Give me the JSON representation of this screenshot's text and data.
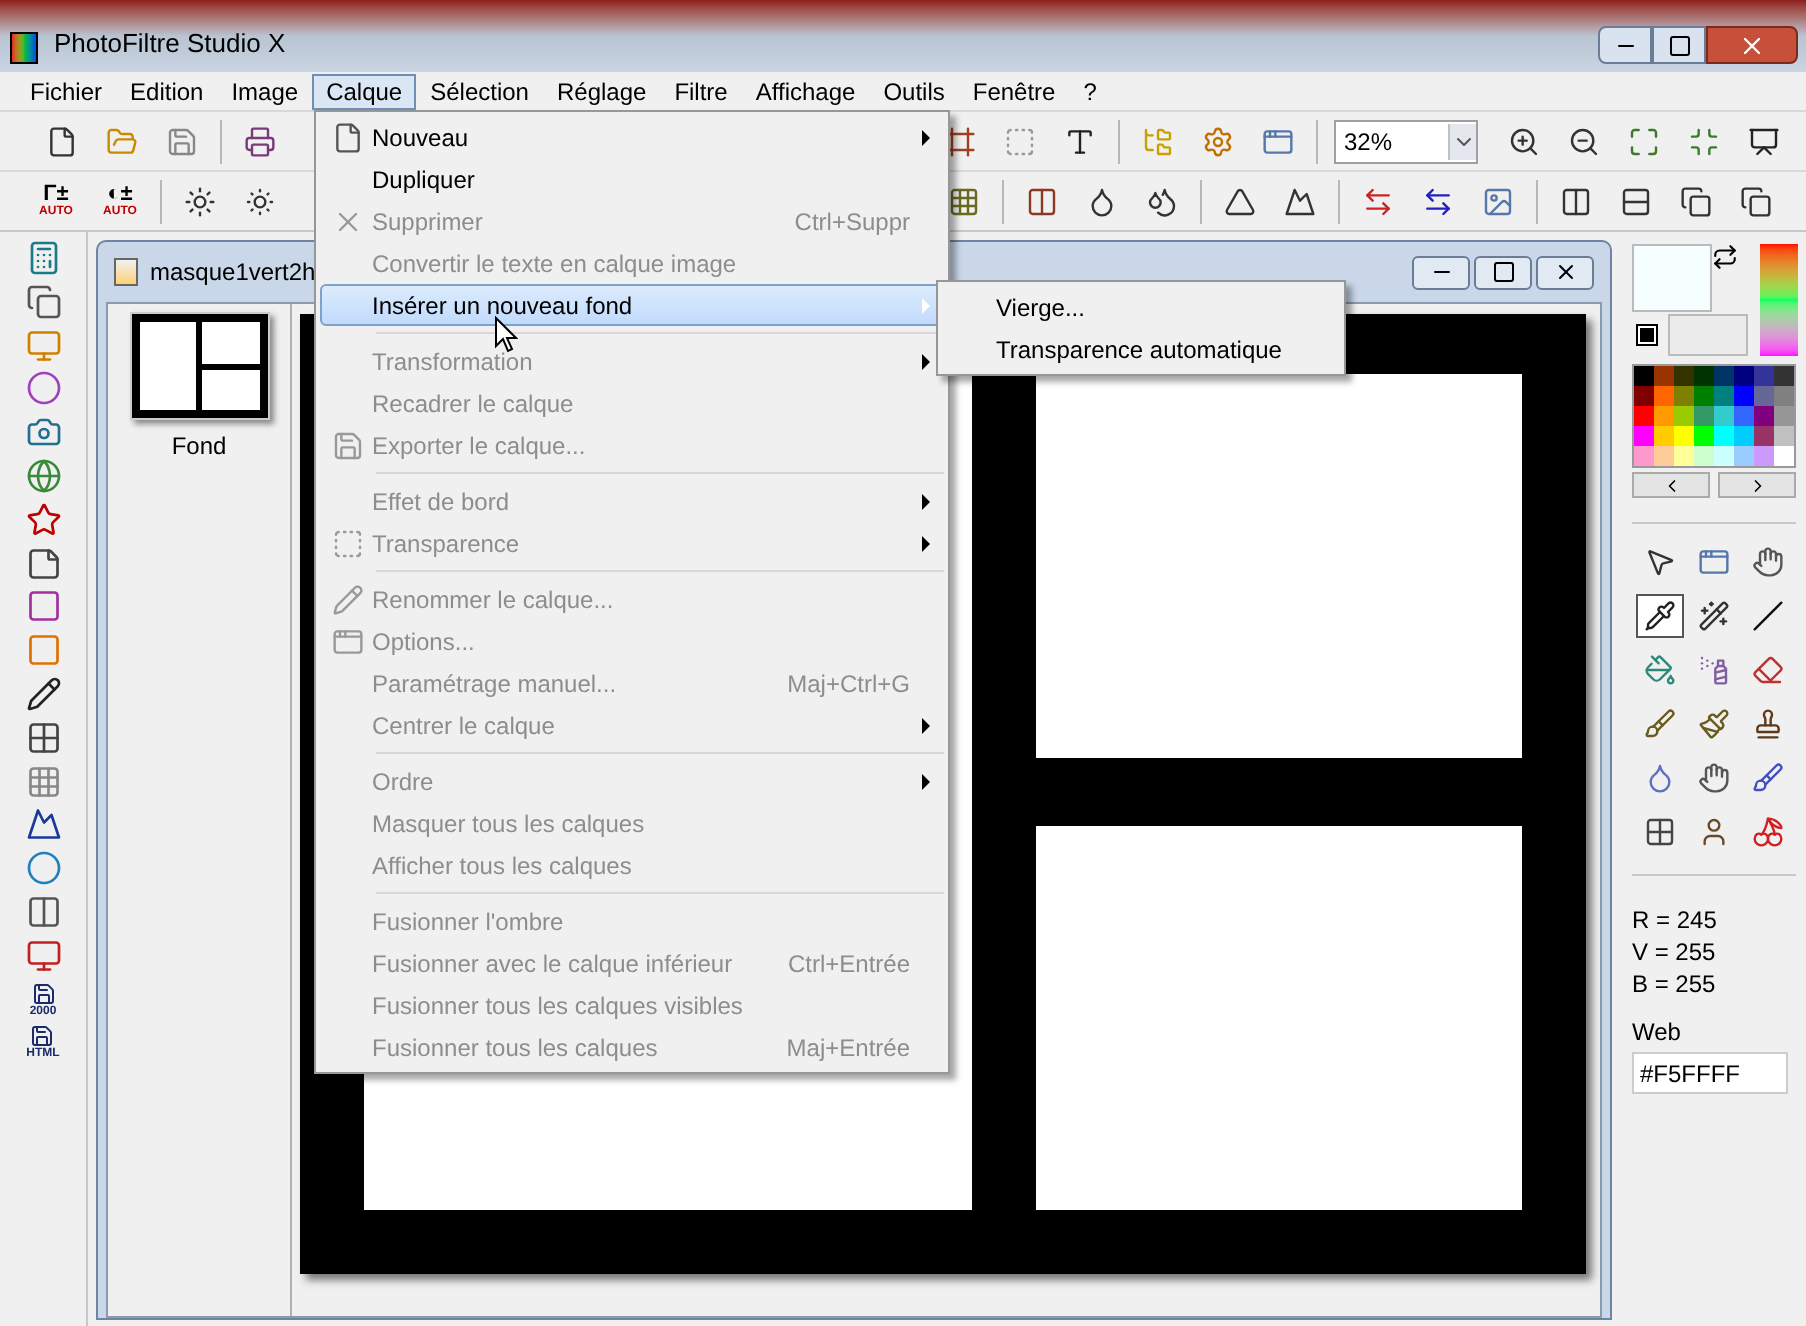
{
  "window": {
    "title": "PhotoFiltre Studio X"
  },
  "menu_bar": [
    {
      "label": "Fichier",
      "selected": false
    },
    {
      "label": "Edition",
      "selected": false
    },
    {
      "label": "Image",
      "selected": false
    },
    {
      "label": "Calque",
      "selected": true
    },
    {
      "label": "Sélection",
      "selected": false
    },
    {
      "label": "Réglage",
      "selected": false
    },
    {
      "label": "Filtre",
      "selected": false
    },
    {
      "label": "Affichage",
      "selected": false
    },
    {
      "label": "Outils",
      "selected": false
    },
    {
      "label": "Fenêtre",
      "selected": false
    },
    {
      "label": "?",
      "selected": false
    }
  ],
  "toolbar": {
    "zoom": {
      "value": "32%"
    },
    "auto_buttons": [
      {
        "symbol": "Γ±",
        "caption": "AUTO"
      },
      {
        "symbol": "◐±",
        "caption": "AUTO"
      }
    ]
  },
  "left_toolbar": {
    "captions": [
      "2000",
      "HTML"
    ]
  },
  "document": {
    "title": "masque1vert2h",
    "layers": [
      {
        "label": "Fond",
        "selected": false
      }
    ]
  },
  "layer_menu": [
    {
      "kind": "item",
      "label": "Nouveau",
      "disabled": false,
      "selected": false,
      "submenu": true
    },
    {
      "kind": "item",
      "label": "Dupliquer",
      "disabled": false,
      "selected": false,
      "submenu": false
    },
    {
      "kind": "item",
      "label": "Supprimer",
      "disabled": true,
      "selected": false,
      "submenu": false,
      "shortcut": "Ctrl+Suppr"
    },
    {
      "kind": "item",
      "label": "Convertir le texte en calque image",
      "disabled": true,
      "selected": false,
      "submenu": false
    },
    {
      "kind": "item",
      "label": "Insérer un nouveau fond",
      "disabled": false,
      "selected": true,
      "submenu": true
    },
    {
      "kind": "separator"
    },
    {
      "kind": "item",
      "label": "Transformation",
      "disabled": true,
      "selected": false,
      "submenu": true
    },
    {
      "kind": "item",
      "label": "Recadrer le calque",
      "disabled": true,
      "selected": false,
      "submenu": false
    },
    {
      "kind": "item",
      "label": "Exporter le calque...",
      "disabled": true,
      "selected": false,
      "submenu": false
    },
    {
      "kind": "separator"
    },
    {
      "kind": "item",
      "label": "Effet de bord",
      "disabled": true,
      "selected": false,
      "submenu": true
    },
    {
      "kind": "item",
      "label": "Transparence",
      "disabled": true,
      "selected": false,
      "submenu": true
    },
    {
      "kind": "separator"
    },
    {
      "kind": "item",
      "label": "Renommer le calque...",
      "disabled": true,
      "selected": false,
      "submenu": false
    },
    {
      "kind": "item",
      "label": "Options...",
      "disabled": true,
      "selected": false,
      "submenu": false
    },
    {
      "kind": "item",
      "label": "Paramétrage manuel...",
      "disabled": true,
      "selected": false,
      "submenu": false,
      "shortcut": "Maj+Ctrl+G"
    },
    {
      "kind": "item",
      "label": "Centrer le calque",
      "disabled": true,
      "selected": false,
      "submenu": true
    },
    {
      "kind": "separator"
    },
    {
      "kind": "item",
      "label": "Ordre",
      "disabled": true,
      "selected": false,
      "submenu": true
    },
    {
      "kind": "item",
      "label": "Masquer tous les calques",
      "disabled": true,
      "selected": false,
      "submenu": false
    },
    {
      "kind": "item",
      "label": "Afficher tous les calques",
      "disabled": true,
      "selected": false,
      "submenu": false
    },
    {
      "kind": "separator"
    },
    {
      "kind": "item",
      "label": "Fusionner l'ombre",
      "disabled": true,
      "selected": false,
      "submenu": false
    },
    {
      "kind": "item",
      "label": "Fusionner avec le calque inférieur",
      "disabled": true,
      "selected": false,
      "submenu": false,
      "shortcut": "Ctrl+Entrée"
    },
    {
      "kind": "item",
      "label": "Fusionner tous les calques visibles",
      "disabled": true,
      "selected": false,
      "submenu": false
    },
    {
      "kind": "item",
      "label": "Fusionner tous les calques",
      "disabled": true,
      "selected": false,
      "submenu": false,
      "shortcut": "Maj+Entrée"
    }
  ],
  "submenu": [
    {
      "label": "Vierge..."
    },
    {
      "label": "Transparence automatique"
    }
  ],
  "color_panel": {
    "color": "#f5ffff",
    "readings": [
      "R = 245",
      "V = 255",
      "B = 255"
    ],
    "web_label": "Web",
    "web_value": "#F5FFFF"
  }
}
